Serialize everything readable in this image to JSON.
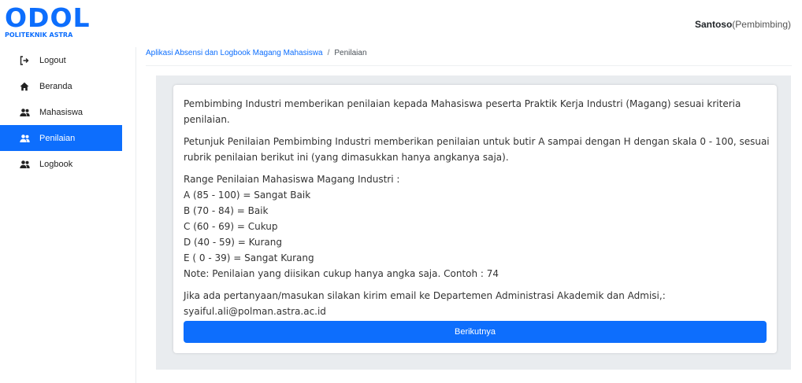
{
  "brand": {
    "logo_main": "ODOL",
    "logo_sub": "POLITEKNIK ASTRA"
  },
  "user": {
    "name": "Santoso",
    "role": "(Pembimbing)"
  },
  "sidebar": {
    "items": [
      {
        "label": "Logout",
        "icon": "logout-icon",
        "active": false
      },
      {
        "label": "Beranda",
        "icon": "home-icon",
        "active": false
      },
      {
        "label": "Mahasiswa",
        "icon": "users-icon",
        "active": false
      },
      {
        "label": "Penilaian",
        "icon": "users-icon",
        "active": true
      },
      {
        "label": "Logbook",
        "icon": "users-icon",
        "active": false
      }
    ]
  },
  "breadcrumb": {
    "link": "Aplikasi Absensi dan Logbook Magang Mahasiswa",
    "separator": "/",
    "current": "Penilaian"
  },
  "content": {
    "intro": "Pembimbing Industri memberikan penilaian kepada Mahasiswa peserta Praktik Kerja Industri (Magang) sesuai kriteria penilaian.",
    "instructions": "Petunjuk Penilaian Pembimbing Industri memberikan penilaian untuk butir A sampai dengan H dengan skala 0 - 100, sesuai rubrik penilaian berikut ini (yang dimasukkan hanya angkanya saja).",
    "range_title": "Range Penilaian Mahasiswa Magang Industri :",
    "ranges": [
      "A (85 - 100) = Sangat Baik",
      "B (70 - 84) = Baik",
      "C (60 - 69) = Cukup",
      "D (40 - 59) = Kurang",
      "E ( 0 - 39) = Sangat Kurang"
    ],
    "note": "Note: Penilaian yang diisikan cukup hanya angka saja. Contoh : 74",
    "contact": "Jika ada pertanyaan/masukan silakan kirim email ke Departemen Administrasi Akademik dan Admisi,:",
    "email": "syaiful.ali@polman.astra.ac.id"
  },
  "actions": {
    "next_label": "Berikutnya"
  },
  "colors": {
    "accent": "#0d6efd",
    "panel_bg": "#e9ecef"
  }
}
